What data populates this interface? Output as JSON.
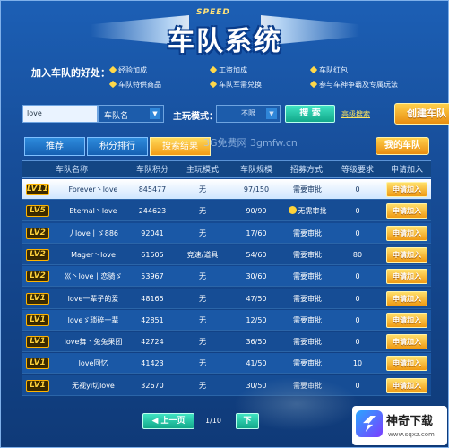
{
  "header": {
    "speed_text": "SPEED",
    "title": "车队系统"
  },
  "benefits": {
    "heading": "加入车队的好处：",
    "items": [
      "经验加成",
      "工资加成",
      "车队红包",
      "车队特供商品",
      "车队军需兑换",
      "参与车神争霸及专属玩法"
    ]
  },
  "search": {
    "input_value": "love",
    "field_select": "车队名",
    "mode_label": "主玩模式：",
    "mode_select": "不限",
    "search_button": "搜 索",
    "advanced_link": "高级搜索",
    "create_button": "创建车队"
  },
  "tabs": [
    {
      "label": "推荐",
      "active": false
    },
    {
      "label": "积分排行",
      "active": false
    },
    {
      "label": "搜索结果",
      "active": true
    }
  ],
  "watermark": "3G免费网  3gmfw.cn",
  "my_team_button": "我的车队",
  "table": {
    "headers": [
      "车队名称",
      "车队积分",
      "主玩模式",
      "车队规模",
      "招募方式",
      "等级要求",
      "申请加入"
    ],
    "rows": [
      {
        "level": "LV11",
        "name": "Forever丶love",
        "points": "845477",
        "mode": "无",
        "size": "97/150",
        "recruit": "需要审批",
        "req": "0",
        "apply": "申请加入",
        "selected": true
      },
      {
        "level": "LV5",
        "name": "Eternal丶love",
        "points": "244623",
        "mode": "无",
        "size": "90/90",
        "recruit": "无需审批",
        "req": "0",
        "apply": "申请加入",
        "selected": false
      },
      {
        "level": "LV2",
        "name": "丿love丨ゞ886",
        "points": "92041",
        "mode": "无",
        "size": "17/60",
        "recruit": "需要审批",
        "req": "0",
        "apply": "申请加入",
        "selected": false
      },
      {
        "level": "LV2",
        "name": "Mager丶love",
        "points": "61505",
        "mode": "竞速/道具",
        "size": "54/60",
        "recruit": "需要审批",
        "req": "80",
        "apply": "申请加入",
        "selected": false
      },
      {
        "level": "LV2",
        "name": "巛丶love丨恋骑ゞ",
        "points": "53967",
        "mode": "无",
        "size": "30/60",
        "recruit": "需要审批",
        "req": "0",
        "apply": "申请加入",
        "selected": false
      },
      {
        "level": "LV1",
        "name": "love一辈子的爱",
        "points": "48165",
        "mode": "无",
        "size": "47/50",
        "recruit": "需要审批",
        "req": "0",
        "apply": "申请加入",
        "selected": false
      },
      {
        "level": "LV1",
        "name": "loveゞ琐碎一辈",
        "points": "42851",
        "mode": "无",
        "size": "12/50",
        "recruit": "需要审批",
        "req": "0",
        "apply": "申请加入",
        "selected": false
      },
      {
        "level": "LV1",
        "name": "love舞丶兔兔果团",
        "points": "42724",
        "mode": "无",
        "size": "36/50",
        "recruit": "需要审批",
        "req": "0",
        "apply": "申请加入",
        "selected": false
      },
      {
        "level": "LV1",
        "name": "love回忆",
        "points": "41423",
        "mode": "无",
        "size": "41/50",
        "recruit": "需要审批",
        "req": "10",
        "apply": "申请加入",
        "selected": false
      },
      {
        "level": "LV1",
        "name": "无视yi切love",
        "points": "32670",
        "mode": "无",
        "size": "30/50",
        "recruit": "需要审批",
        "req": "0",
        "apply": "申请加入",
        "selected": false
      }
    ]
  },
  "pagination": {
    "prev": "上一页",
    "page": "1/10",
    "next": "下"
  },
  "corner_brand": {
    "name": "神奇下载",
    "url": "www.sqxz.com"
  }
}
